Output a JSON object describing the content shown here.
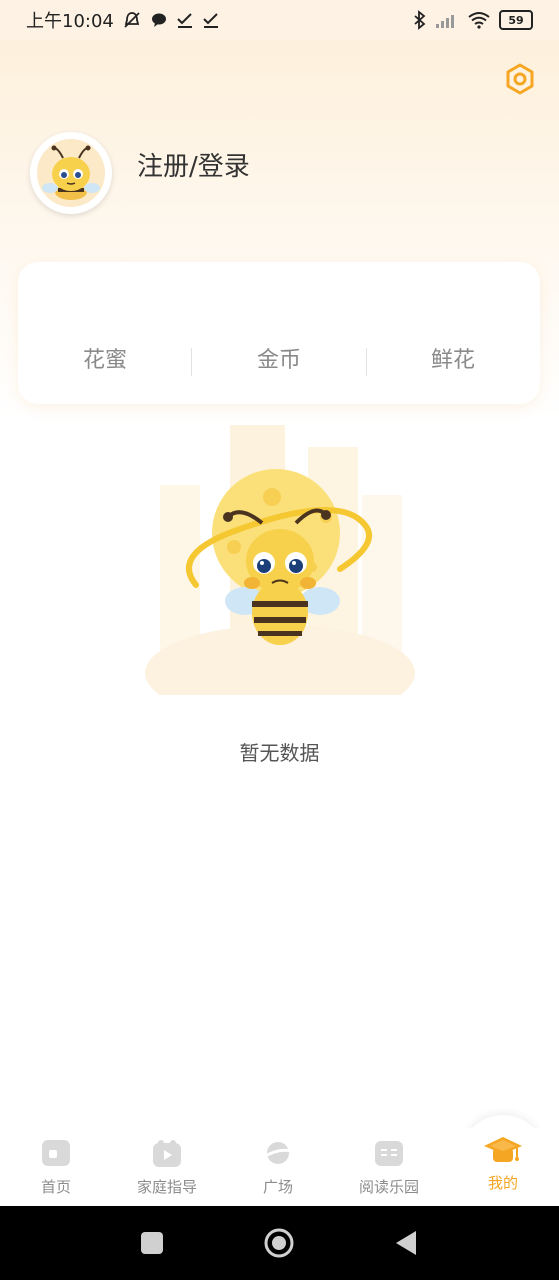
{
  "status_bar": {
    "time": "上午10:04",
    "battery": "59",
    "icons": [
      "mute-bell-icon",
      "chat-icon",
      "check-icon",
      "check-icon",
      "bluetooth-icon",
      "signal-icon",
      "wifi-icon",
      "battery-icon"
    ]
  },
  "header": {
    "login_label": "注册/登录",
    "settings_icon": "settings-hexagon-icon",
    "avatar_icon": "bee-avatar-icon"
  },
  "stats": {
    "items": [
      {
        "label": "花蜜"
      },
      {
        "label": "金币"
      },
      {
        "label": "鲜花"
      }
    ]
  },
  "empty_state": {
    "illustration": "bee-moon-illustration",
    "text": "暂无数据"
  },
  "tab_bar": {
    "tabs": [
      {
        "label": "首页",
        "icon": "home-icon",
        "active": false
      },
      {
        "label": "家庭指导",
        "icon": "family-guide-icon",
        "active": false
      },
      {
        "label": "广场",
        "icon": "planet-icon",
        "active": false
      },
      {
        "label": "阅读乐园",
        "icon": "book-icon",
        "active": false
      },
      {
        "label": "我的",
        "icon": "graduation-cap-icon",
        "active": true
      }
    ],
    "active_color": "#f5a623",
    "inactive_color": "#8c8c8c"
  },
  "colors": {
    "accent": "#f5a623",
    "header_gradient_top": "#fdefd8"
  },
  "system_nav": {
    "buttons": [
      "recent-apps-icon",
      "home-circle-icon",
      "back-triangle-icon"
    ]
  }
}
